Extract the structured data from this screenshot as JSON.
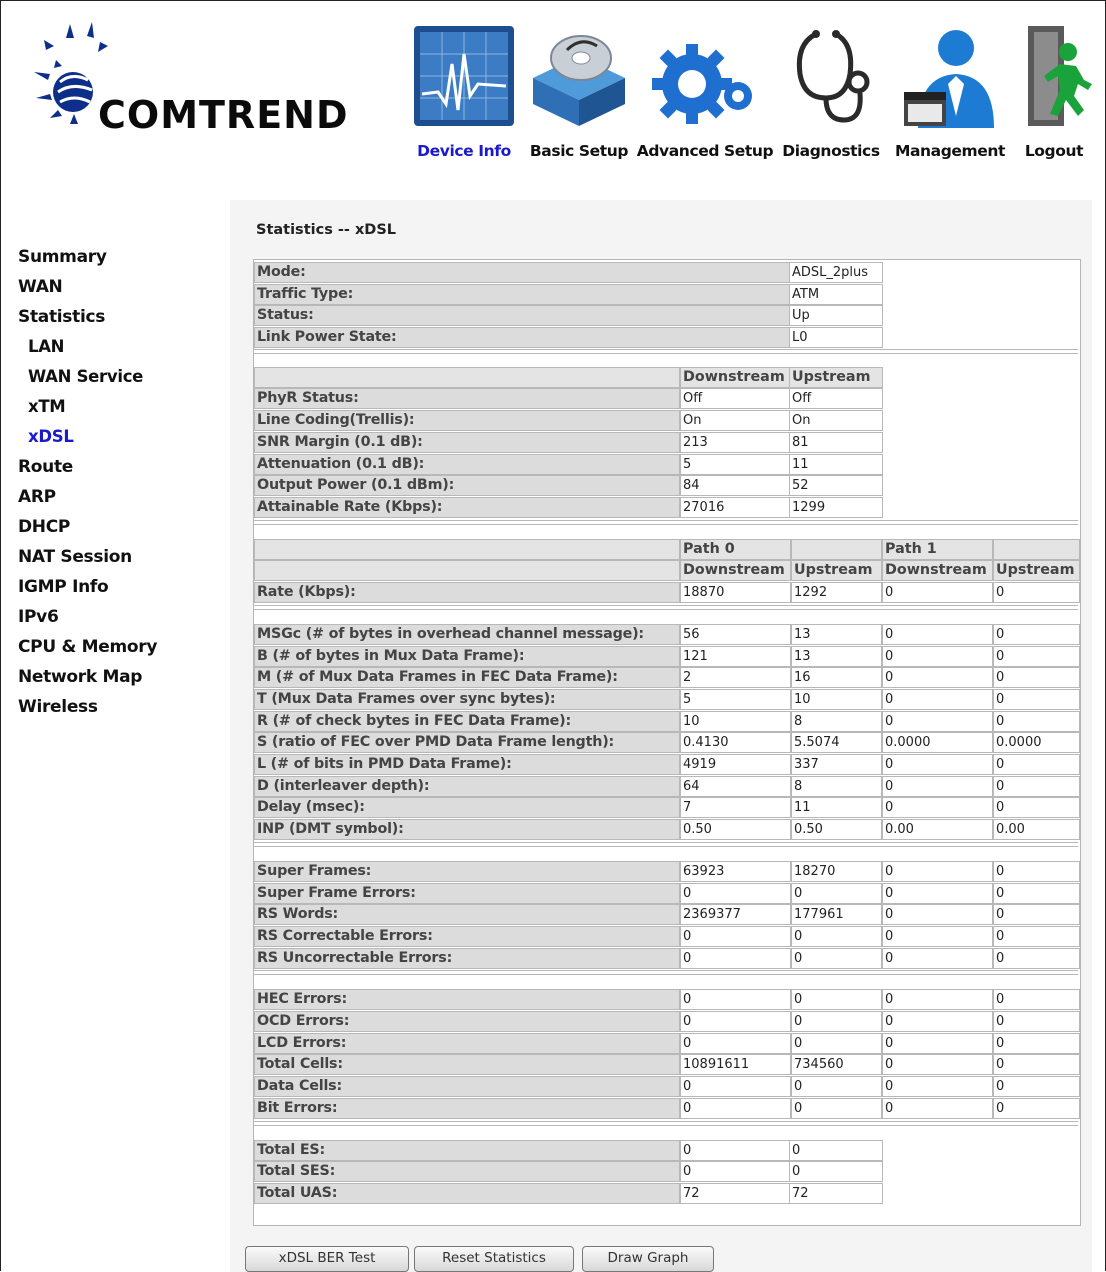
{
  "brand": {
    "name": "COMTREND"
  },
  "nav": [
    {
      "label": "Device Info",
      "icon": "device-info-icon",
      "active": true
    },
    {
      "label": "Basic Setup",
      "icon": "basic-setup-icon"
    },
    {
      "label": "Advanced Setup",
      "icon": "advanced-setup-icon"
    },
    {
      "label": "Diagnostics",
      "icon": "diagnostics-icon"
    },
    {
      "label": "Management",
      "icon": "management-icon"
    },
    {
      "label": "Logout",
      "icon": "logout-icon"
    }
  ],
  "sidebar": [
    {
      "label": "Summary"
    },
    {
      "label": "WAN"
    },
    {
      "label": "Statistics"
    },
    {
      "label": "LAN",
      "sub": true
    },
    {
      "label": "WAN Service",
      "sub": true
    },
    {
      "label": "xTM",
      "sub": true
    },
    {
      "label": "xDSL",
      "sub": true,
      "active": true
    },
    {
      "label": "Route"
    },
    {
      "label": "ARP"
    },
    {
      "label": "DHCP"
    },
    {
      "label": "NAT Session"
    },
    {
      "label": "IGMP Info"
    },
    {
      "label": "IPv6"
    },
    {
      "label": "CPU & Memory"
    },
    {
      "label": "Network Map"
    },
    {
      "label": "Wireless"
    }
  ],
  "page_title": "Statistics -- xDSL",
  "general": [
    {
      "label": "Mode:",
      "value": "ADSL_2plus"
    },
    {
      "label": "Traffic Type:",
      "value": "ATM"
    },
    {
      "label": "Status:",
      "value": "Up"
    },
    {
      "label": "Link Power State:",
      "value": "L0"
    }
  ],
  "dir_headers": {
    "downstream": "Downstream",
    "upstream": "Upstream"
  },
  "line_stats": [
    {
      "label": "PhyR Status:",
      "down": "Off",
      "up": "Off"
    },
    {
      "label": "Line Coding(Trellis):",
      "down": "On",
      "up": "On"
    },
    {
      "label": "SNR Margin (0.1 dB):",
      "down": "213",
      "up": "81"
    },
    {
      "label": "Attenuation (0.1 dB):",
      "down": "5",
      "up": "11"
    },
    {
      "label": "Output Power (0.1 dBm):",
      "down": "84",
      "up": "52"
    },
    {
      "label": "Attainable Rate (Kbps):",
      "down": "27016",
      "up": "1299"
    }
  ],
  "path_headers": {
    "path0": "Path 0",
    "path1": "Path 1",
    "downstream": "Downstream",
    "upstream": "Upstream"
  },
  "rate": {
    "label": "Rate (Kbps):",
    "values": [
      "18870",
      "1292",
      "0",
      "0"
    ]
  },
  "framing": [
    {
      "label": "MSGc (# of bytes in overhead channel message):",
      "values": [
        "56",
        "13",
        "0",
        "0"
      ]
    },
    {
      "label": "B (# of bytes in Mux Data Frame):",
      "values": [
        "121",
        "13",
        "0",
        "0"
      ]
    },
    {
      "label": "M (# of Mux Data Frames in FEC Data Frame):",
      "values": [
        "2",
        "16",
        "0",
        "0"
      ]
    },
    {
      "label": "T (Mux Data Frames over sync bytes):",
      "values": [
        "5",
        "10",
        "0",
        "0"
      ]
    },
    {
      "label": "R (# of check bytes in FEC Data Frame):",
      "values": [
        "10",
        "8",
        "0",
        "0"
      ]
    },
    {
      "label": "S (ratio of FEC over PMD Data Frame length):",
      "values": [
        "0.4130",
        "5.5074",
        "0.0000",
        "0.0000"
      ]
    },
    {
      "label": "L (# of bits in PMD Data Frame):",
      "values": [
        "4919",
        "337",
        "0",
        "0"
      ]
    },
    {
      "label": "D (interleaver depth):",
      "values": [
        "64",
        "8",
        "0",
        "0"
      ]
    },
    {
      "label": "Delay (msec):",
      "values": [
        "7",
        "11",
        "0",
        "0"
      ]
    },
    {
      "label": "INP (DMT symbol):",
      "values": [
        "0.50",
        "0.50",
        "0.00",
        "0.00"
      ]
    }
  ],
  "frames": [
    {
      "label": "Super Frames:",
      "values": [
        "63923",
        "18270",
        "0",
        "0"
      ]
    },
    {
      "label": "Super Frame Errors:",
      "values": [
        "0",
        "0",
        "0",
        "0"
      ]
    },
    {
      "label": "RS Words:",
      "values": [
        "2369377",
        "177961",
        "0",
        "0"
      ]
    },
    {
      "label": "RS Correctable Errors:",
      "values": [
        "0",
        "0",
        "0",
        "0"
      ]
    },
    {
      "label": "RS Uncorrectable Errors:",
      "values": [
        "0",
        "0",
        "0",
        "0"
      ]
    }
  ],
  "cells": [
    {
      "label": "HEC Errors:",
      "values": [
        "0",
        "0",
        "0",
        "0"
      ]
    },
    {
      "label": "OCD Errors:",
      "values": [
        "0",
        "0",
        "0",
        "0"
      ]
    },
    {
      "label": "LCD Errors:",
      "values": [
        "0",
        "0",
        "0",
        "0"
      ]
    },
    {
      "label": "Total Cells:",
      "values": [
        "10891611",
        "734560",
        "0",
        "0"
      ]
    },
    {
      "label": "Data Cells:",
      "values": [
        "0",
        "0",
        "0",
        "0"
      ]
    },
    {
      "label": "Bit Errors:",
      "values": [
        "0",
        "0",
        "0",
        "0"
      ]
    }
  ],
  "totals": [
    {
      "label": "Total ES:",
      "values": [
        "0",
        "0"
      ]
    },
    {
      "label": "Total SES:",
      "values": [
        "0",
        "0"
      ]
    },
    {
      "label": "Total UAS:",
      "values": [
        "72",
        "72"
      ]
    }
  ],
  "buttons": {
    "ber_test": "xDSL BER Test",
    "reset": "Reset Statistics",
    "graph": "Draw Graph"
  }
}
